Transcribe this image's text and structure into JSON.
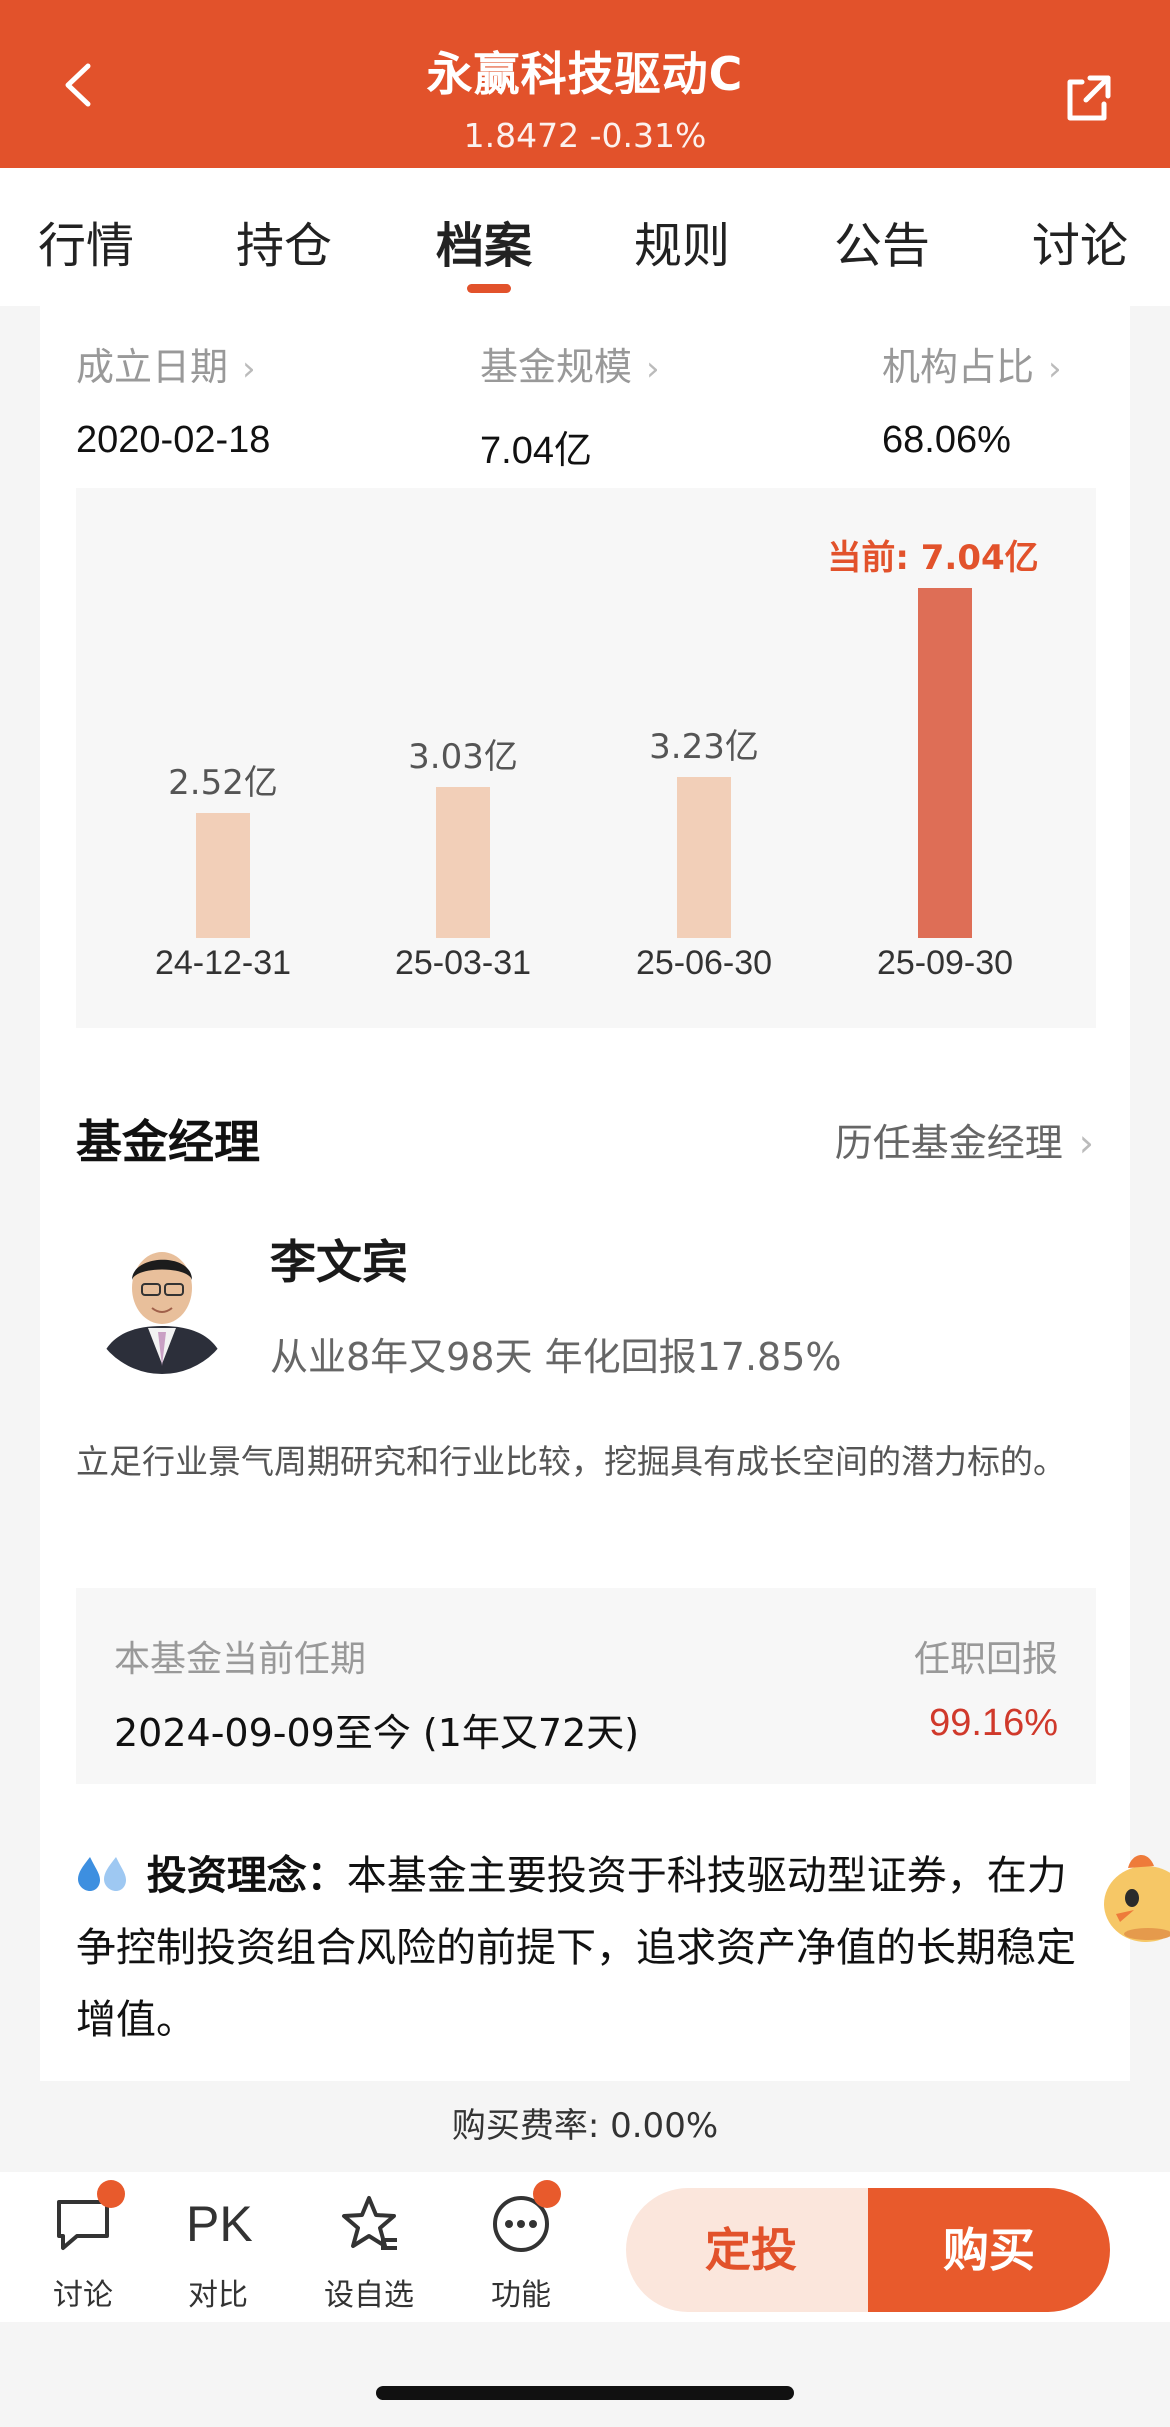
{
  "header": {
    "title": "永赢科技驱动C",
    "subtitle": "1.8472 -0.31%",
    "back_icon": "chevron-left-icon",
    "share_icon": "share-icon"
  },
  "tabs": [
    {
      "label": "行情"
    },
    {
      "label": "持仓"
    },
    {
      "label": "档案",
      "active": true
    },
    {
      "label": "规则"
    },
    {
      "label": "公告"
    },
    {
      "label": "讨论"
    }
  ],
  "stats": {
    "established": {
      "label": "成立日期",
      "value": "2020-02-18"
    },
    "scale": {
      "label": "基金规模",
      "value": "7.04亿"
    },
    "institution": {
      "label": "机构占比",
      "value": "68.06%"
    }
  },
  "chart_data": {
    "type": "bar",
    "categories": [
      "24-12-31",
      "25-03-31",
      "25-06-30",
      "25-09-30"
    ],
    "values": [
      2.52,
      3.03,
      3.23,
      7.04
    ],
    "labels": [
      "2.52亿",
      "3.03亿",
      "3.23亿",
      "当前: 7.04亿"
    ],
    "unit": "亿",
    "colors": {
      "normal": "#f2cfb8",
      "current": "#de6e56",
      "current_label": "#e2522b"
    }
  },
  "manager_section": {
    "title": "基金经理",
    "history_link": "历任基金经理",
    "name": "李文宾",
    "info": "从业8年又98天 年化回报17.85%",
    "description": "立足行业景气周期研究和行业比较，挖掘具有成长空间的潜力标的。",
    "tenure_label": "本基金当前任期",
    "tenure_value": "2024-09-09至今 (1年又72天)",
    "return_label": "任职回报",
    "return_value": "99.16%"
  },
  "philosophy": {
    "label": "投资理念：",
    "text": "本基金主要投资于科技驱动型证券，在力争控制投资组合风险的前提下，追求资产净值的长期稳定增值。"
  },
  "fee": "购买费率: 0.00%",
  "bottom_bar": {
    "items": [
      {
        "label": "讨论",
        "icon": "chat-icon",
        "dot": true
      },
      {
        "label": "对比",
        "icon": "pk-icon",
        "icon_text": "PK",
        "dot": false
      },
      {
        "label": "设自选",
        "icon": "star-icon",
        "dot": false
      },
      {
        "label": "功能",
        "icon": "more-icon",
        "dot": true
      }
    ],
    "dingtou": "定投",
    "buy": "购买"
  },
  "colors": {
    "brand": "#e2522b",
    "positive": "#d0392b"
  }
}
